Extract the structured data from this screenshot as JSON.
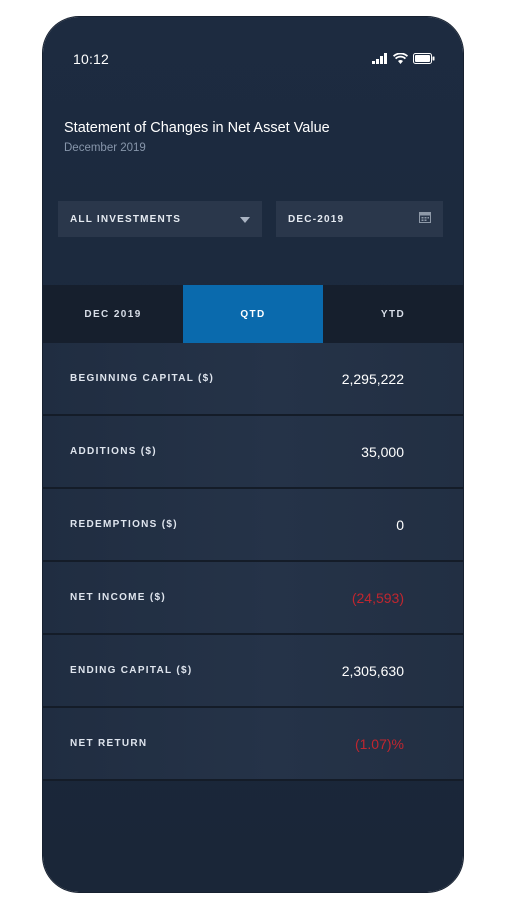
{
  "status_bar": {
    "time": "10:12",
    "icons": [
      "signal-icon",
      "wifi-icon",
      "battery-icon"
    ]
  },
  "header": {
    "title": "Statement of Changes in Net Asset Value",
    "subtitle": "December 2019"
  },
  "filters": {
    "investment_dropdown": {
      "value": "ALL INVESTMENTS",
      "icon": "caret-down-icon"
    },
    "date_field": {
      "value": "DEC-2019",
      "icon": "calendar-icon"
    }
  },
  "tabs": [
    {
      "label": "DEC 2019",
      "active": false
    },
    {
      "label": "QTD",
      "active": true
    },
    {
      "label": "YTD",
      "active": false
    }
  ],
  "rows": [
    {
      "label": "BEGINNING CAPITAL ($)",
      "value": "2,295,222",
      "negative": false
    },
    {
      "label": "ADDITIONS ($)",
      "value": "35,000",
      "negative": false
    },
    {
      "label": "REDEMPTIONS ($)",
      "value": "0",
      "negative": false
    },
    {
      "label": "NET INCOME ($)",
      "value": "(24,593)",
      "negative": true
    },
    {
      "label": "ENDING CAPITAL ($)",
      "value": "2,305,630",
      "negative": false
    },
    {
      "label": "NET RETURN",
      "value": "(1.07)%",
      "negative": true
    }
  ],
  "colors": {
    "background": "#1d2b40",
    "accent_tab": "#0a6aad",
    "negative": "#c0262f",
    "control_bg": "#2a374b"
  }
}
